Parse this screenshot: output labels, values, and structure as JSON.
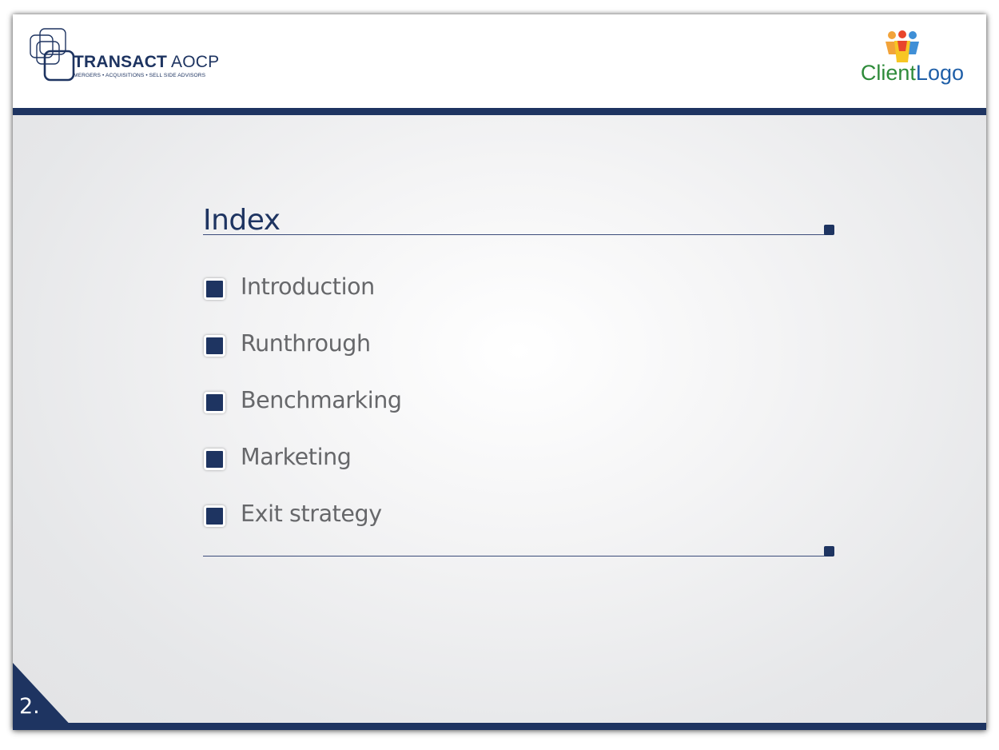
{
  "header": {
    "brand": {
      "name_bold": "TRANSACT",
      "name_light": "AOCP",
      "tagline": "MERGERS • ACQUISITIONS • SELL SIDE ADVISORS",
      "logo_icon": "overlapping-squares-logo"
    },
    "client_logo": {
      "text_part1": "Client",
      "text_part2": "Logo",
      "icon": "people-group-icon"
    }
  },
  "content": {
    "title": "Index",
    "items": [
      {
        "label": "Introduction"
      },
      {
        "label": "Runthrough"
      },
      {
        "label": "Benchmarking"
      },
      {
        "label": "Marketing"
      },
      {
        "label": "Exit strategy"
      }
    ]
  },
  "footer": {
    "page_number": "2."
  },
  "colors": {
    "navy": "#1e3461",
    "text_gray": "#66676a",
    "client_green": "#2e8b3a",
    "client_blue": "#1f5fa8"
  }
}
